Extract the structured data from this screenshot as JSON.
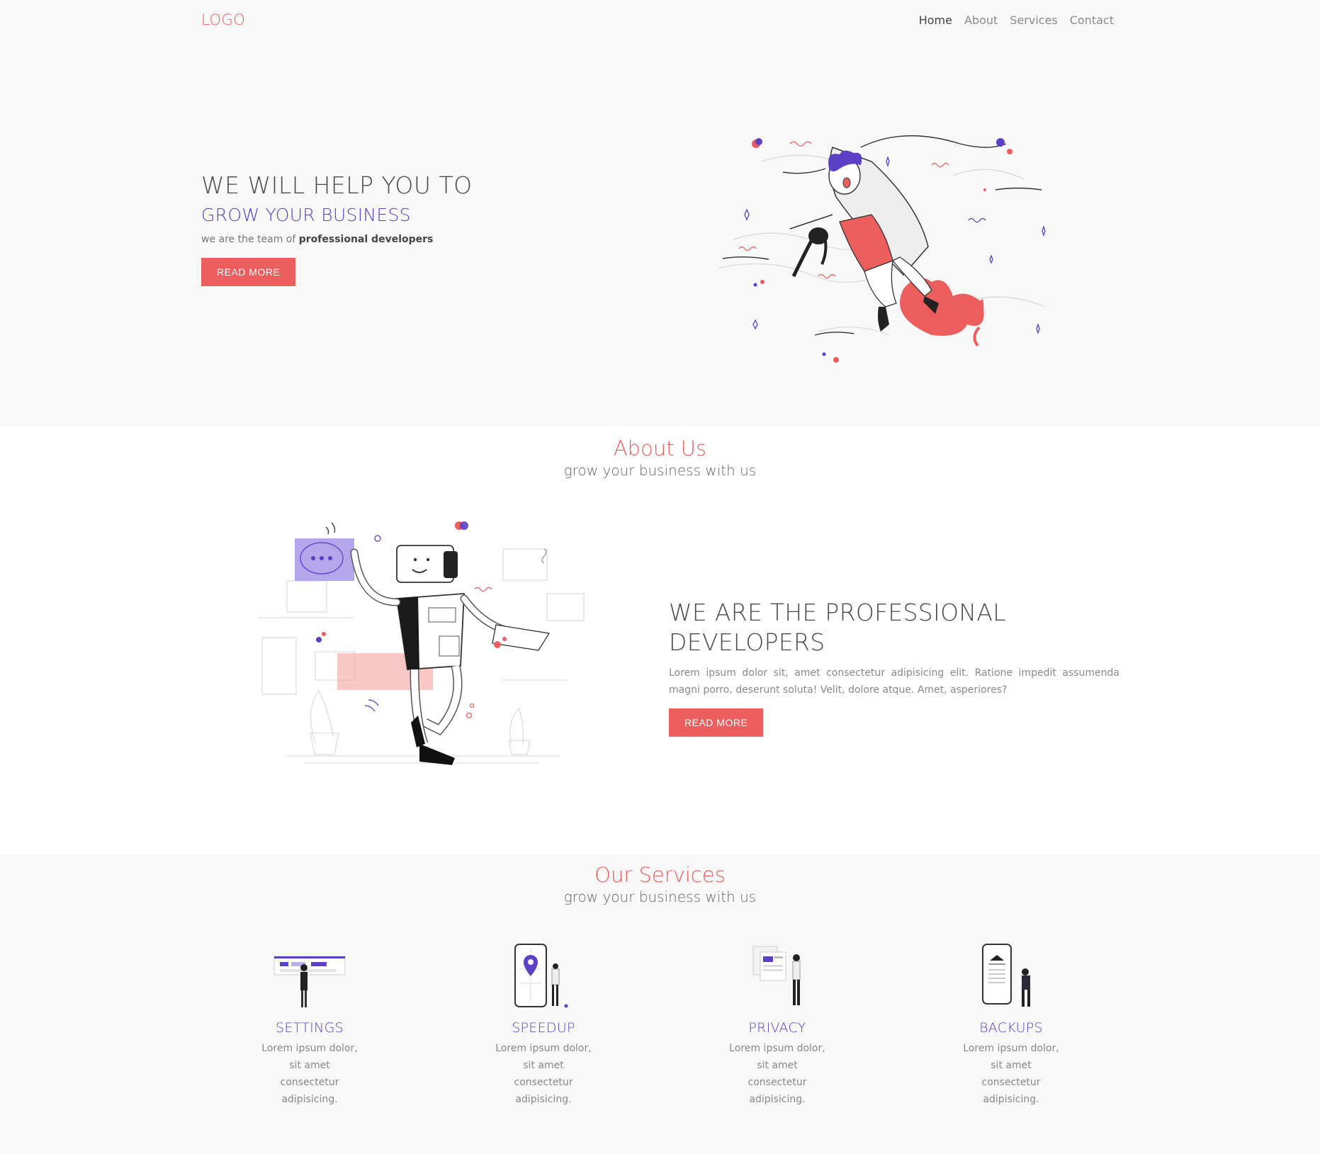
{
  "navbar": {
    "logo": "LOGO",
    "links": [
      "Home",
      "About",
      "Services",
      "Contact"
    ],
    "active": "Home"
  },
  "hero": {
    "title": "WE WILL HELP YOU TO",
    "subtitle": "GROW YOUR BUSINESS",
    "desc_prefix": "we are the team of ",
    "desc_bold": "professional developers",
    "button": "READ MORE"
  },
  "about": {
    "heading": "About Us",
    "subheading": "grow your business with us",
    "title_line1": "WE ARE THE PROFESSIONAL",
    "title_line2": "DEVELOPERS",
    "description": "Lorem ipsum dolor sit, amet consectetur adipisicing elit. Ratione impedit assumenda magni porro, deserunt soluta! Velit, dolore atque. Amet, asperiores?",
    "button": "READ MORE"
  },
  "services": {
    "heading": "Our Services",
    "subheading": "grow your business with us",
    "items": [
      {
        "name": "SETTINGS",
        "desc": "Lorem ipsum dolor, sit amet consectetur adipisicing.",
        "icon": "settings-illustration"
      },
      {
        "name": "SPEEDUP",
        "desc": "Lorem ipsum dolor, sit amet consectetur adipisicing.",
        "icon": "speedup-illustration"
      },
      {
        "name": "PRIVACY",
        "desc": "Lorem ipsum dolor, sit amet consectetur adipisicing.",
        "icon": "privacy-illustration"
      },
      {
        "name": "BACKUPS",
        "desc": "Lorem ipsum dolor, sit amet consectetur adipisicing.",
        "icon": "backups-illustration"
      }
    ]
  },
  "colors": {
    "accent": "#ec5e5d",
    "purple": "#5b3fc4",
    "text": "#4a4a4a"
  }
}
